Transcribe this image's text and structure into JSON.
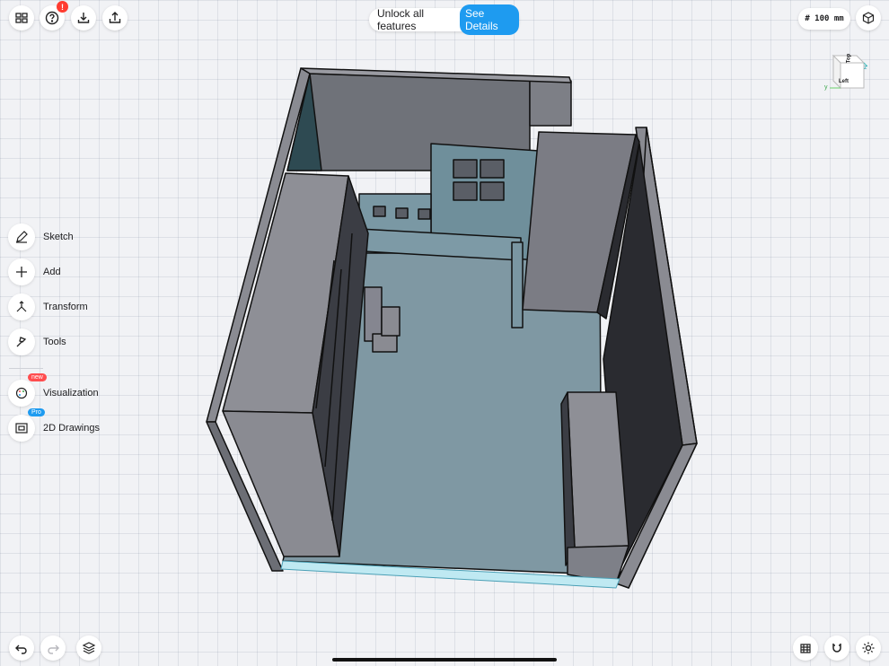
{
  "toolbar": {
    "notification_count": "!",
    "unlock_text": "Unlock all features",
    "see_details": "See Details",
    "grid_size": "# 100 mm"
  },
  "sidebar": {
    "items": [
      {
        "label": "Sketch",
        "icon": "pencil-icon"
      },
      {
        "label": "Add",
        "icon": "plus-icon"
      },
      {
        "label": "Transform",
        "icon": "transform-icon"
      },
      {
        "label": "Tools",
        "icon": "hammer-icon"
      }
    ],
    "visualization": {
      "label": "Visualization",
      "badge": "new",
      "badge_color": "#ff4d4f"
    },
    "drawings": {
      "label": "2D Drawings",
      "badge": "Pro",
      "badge_color": "#1e9bf0"
    }
  },
  "view_cube": {
    "top": "Top",
    "left": "Left",
    "axis_y": "y",
    "axis_z": "z"
  },
  "colors": {
    "accent": "#1e9bf0",
    "wall": "#8b8b93",
    "floor": "#7c97a3"
  }
}
